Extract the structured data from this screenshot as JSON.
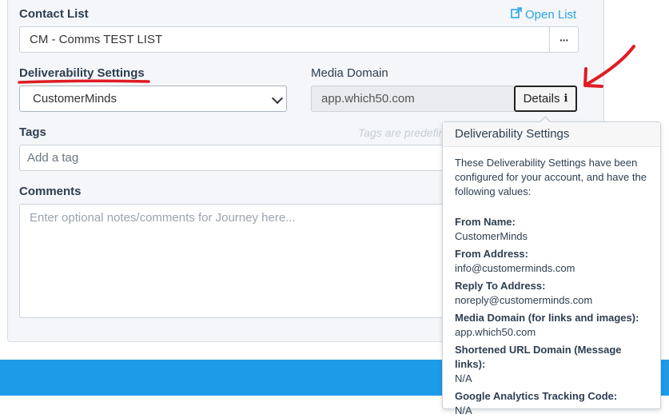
{
  "contact_list": {
    "label": "Contact List",
    "open_list_label": "Open List",
    "value": "CM - Comms TEST LIST",
    "more_button_label": "···"
  },
  "deliverability": {
    "label": "Deliverability Settings",
    "selected": "CustomerMinds"
  },
  "media_domain": {
    "label": "Media Domain",
    "value": "app.which50.com",
    "details_label": "Details"
  },
  "tags": {
    "label": "Tags",
    "hint": "Tags are predefined",
    "placeholder": "Add a tag"
  },
  "comments": {
    "label": "Comments",
    "placeholder": "Enter optional notes/comments for Journey here..."
  },
  "popover": {
    "title": "Deliverability Settings",
    "intro": "These Deliverability Settings have been configured for your account, and have the following values:",
    "fields": [
      {
        "key": "From Name:",
        "value": "CustomerMinds"
      },
      {
        "key": "From Address:",
        "value": "info@customerminds.com"
      },
      {
        "key": "Reply To Address:",
        "value": "noreply@customerminds.com"
      },
      {
        "key": "Media Domain (for links and images):",
        "value": "app.which50.com"
      },
      {
        "key": "Shortened URL Domain (Message links):",
        "value": "N/A"
      },
      {
        "key": "Google Analytics Tracking Code:",
        "value": "N/A"
      }
    ]
  },
  "colors": {
    "accent": "#2aa3e6",
    "annotation_red": "#e01b24",
    "footer_blue": "#1e9be8"
  }
}
